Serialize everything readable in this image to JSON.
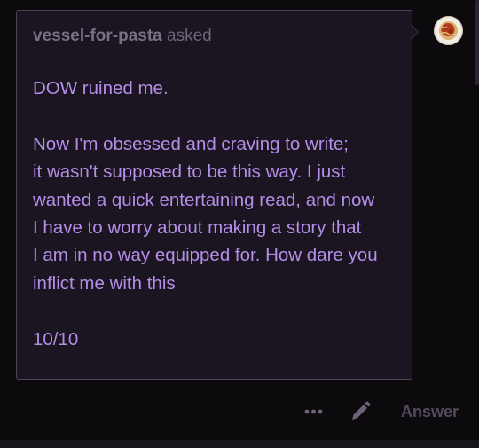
{
  "ask": {
    "asker": "vessel-for-pasta",
    "verb": "asked",
    "question_lines": [
      "DOW ruined me.",
      "",
      "Now I'm obsessed and craving to write;",
      "it wasn't supposed to be this way. I just",
      "wanted a quick entertaining read, and now",
      "I have to worry about making a story that",
      "I am in no way equipped for. How dare you",
      "inflict me with this",
      "",
      "10/10"
    ]
  },
  "actions": {
    "answer_label": "Answer"
  },
  "colors": {
    "background": "#0c0a0d",
    "card": "#1a1520",
    "card_border": "#4c4359",
    "question_text": "#b58ee8",
    "muted_text": "#6e6479",
    "action_icon": "#6b6377"
  },
  "icons": {
    "avatar": "pasta-plate-avatar",
    "more": "more-horizontal-icon",
    "edit": "pencil-icon"
  }
}
